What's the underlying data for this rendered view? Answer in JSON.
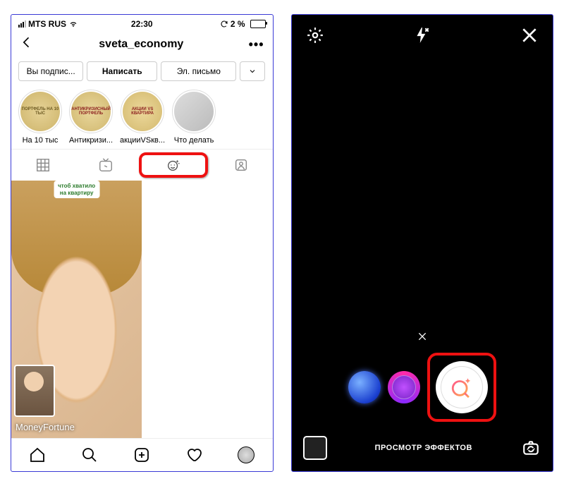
{
  "status": {
    "carrier": "MTS RUS",
    "time": "22:30",
    "battery": "2 %"
  },
  "profile": {
    "username": "sveta_economy",
    "actions": {
      "subscribed": "Вы подпис...",
      "message": "Написать",
      "email": "Эл. письмо"
    },
    "highlights": [
      {
        "title": "ПОРТФЕЛЬ НА 10 ТЫС",
        "label": "На 10 тыс"
      },
      {
        "title": "АНТИКРИЗИСНЫЙ ПОРТФЕЛЬ",
        "label": "Антикризи..."
      },
      {
        "title": "АКЦИИ VS КВАРТИРА",
        "label": "акцииVSкв..."
      },
      {
        "title": "",
        "label": "Что делать"
      }
    ],
    "effect": {
      "sticker_line1": "чтоб хватило",
      "sticker_line2": "на квартиру",
      "name": "MoneyFortune"
    }
  },
  "camera": {
    "browse_label": "ПРОСМОТР ЭФФЕКТОВ"
  }
}
